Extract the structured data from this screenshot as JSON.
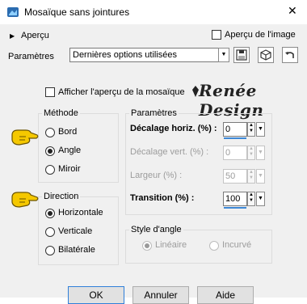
{
  "window": {
    "title": "Mosaïque sans jointures"
  },
  "preview_section": {
    "label": "Aperçu",
    "image_preview_label": "Aperçu de l'image"
  },
  "params_bar": {
    "label": "Paramètres",
    "preset_value": "Dernières options utilisées"
  },
  "show_preview": {
    "label": "Afficher l'aperçu de la mosaïque"
  },
  "watermark_text": "Renée Design",
  "method": {
    "title": "Méthode",
    "options": [
      "Bord",
      "Angle",
      "Miroir"
    ],
    "selected": "Angle"
  },
  "direction": {
    "title": "Direction",
    "options": [
      "Horizontale",
      "Verticale",
      "Bilatérale"
    ],
    "selected": "Horizontale"
  },
  "parameters": {
    "title": "Paramètres",
    "horiz_offset": {
      "label": "Décalage horiz. (%) :",
      "value": "0"
    },
    "vert_offset": {
      "label": "Décalage vert. (%) :",
      "value": "0"
    },
    "width": {
      "label": "Largeur (%) :",
      "value": "50"
    },
    "transition": {
      "label": "Transition (%) :",
      "value": "100"
    }
  },
  "corner_style": {
    "title": "Style d'angle",
    "options": [
      "Linéaire",
      "Incurvé"
    ],
    "selected": "Linéaire"
  },
  "buttons": {
    "ok": "OK",
    "cancel": "Annuler",
    "help": "Aide"
  },
  "colors": {
    "accent": "#2f7fd9",
    "pointer": "#f5c800"
  }
}
